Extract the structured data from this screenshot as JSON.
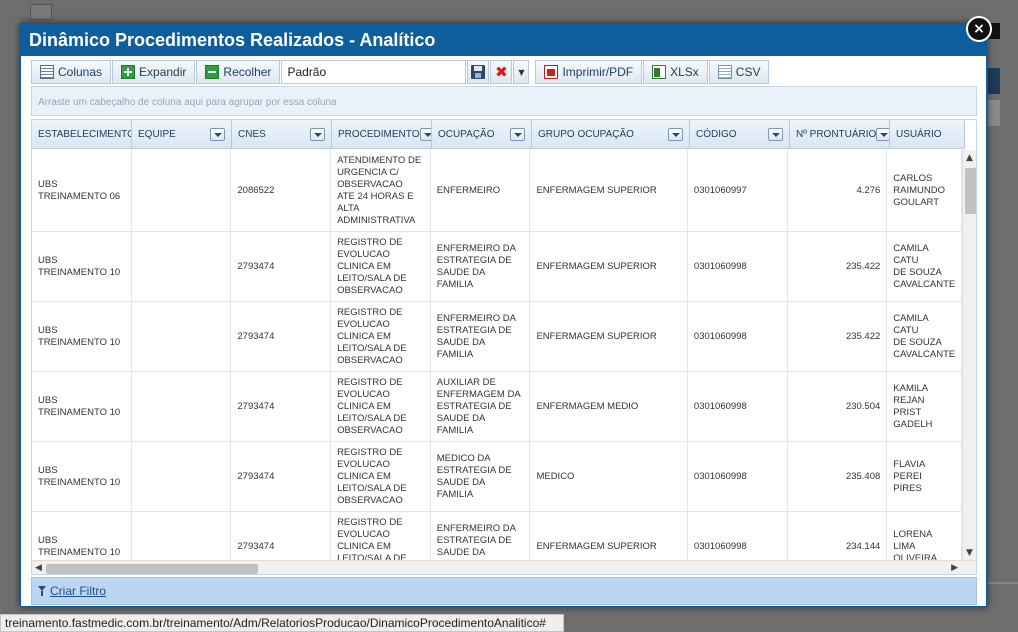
{
  "modal": {
    "title": "Dinâmico Procedimentos Realizados - Analítico",
    "close_label": "×"
  },
  "toolbar": {
    "columns_label": "Colunas",
    "expand_label": "Expandir",
    "collapse_label": "Recolher",
    "layout_value": "Padrão",
    "pdf_label": "Imprimir/PDF",
    "xlsx_label": "XLSx",
    "csv_label": "CSV"
  },
  "group_panel": {
    "hint": "Arraste um cabeçalho de coluna aqui para agrupar por essa coluna"
  },
  "grid": {
    "columns": [
      "ESTABELECIMENTO",
      "EQUIPE",
      "CNES",
      "PROCEDIMENTO",
      "OCUPAÇÃO",
      "GRUPO OCUPAÇÃO",
      "CÓDIGO",
      "Nº PRONTUÁRIO",
      "USUÁRIO"
    ],
    "rows": [
      {
        "estabelecimento": "UBS\nTREINAMENTO 06",
        "equipe": "",
        "cnes": "2086522",
        "procedimento": "ATENDIMENTO DE\nURGENCIA C/\nOBSERVACAO\nATE 24 HORAS E\nALTA\nADMINISTRATIVA",
        "ocupacao": "ENFERMEIRO",
        "grupo": "ENFERMAGEM SUPERIOR",
        "codigo": "0301060997",
        "prontuario": "4.276",
        "usuario": "CARLOS\nRAIMUNDO\nGOULART"
      },
      {
        "estabelecimento": "UBS\nTREINAMENTO 10",
        "equipe": "",
        "cnes": "2793474",
        "procedimento": "REGISTRO DE\nEVOLUCAO\nCLINICA EM\nLEITO/SALA DE\nOBSERVACAO",
        "ocupacao": "ENFERMEIRO DA\nESTRATEGIA DE\nSAUDE DA\nFAMILIA",
        "grupo": "ENFERMAGEM SUPERIOR",
        "codigo": "0301060998",
        "prontuario": "235.422",
        "usuario": "CAMILA CATU\nDE SOUZA\nCAVALCANTE"
      },
      {
        "estabelecimento": "UBS\nTREINAMENTO 10",
        "equipe": "",
        "cnes": "2793474",
        "procedimento": "REGISTRO DE\nEVOLUCAO\nCLINICA EM\nLEITO/SALA DE\nOBSERVACAO",
        "ocupacao": "ENFERMEIRO DA\nESTRATEGIA DE\nSAUDE DA\nFAMILIA",
        "grupo": "ENFERMAGEM SUPERIOR",
        "codigo": "0301060998",
        "prontuario": "235.422",
        "usuario": "CAMILA CATU\nDE SOUZA\nCAVALCANTE"
      },
      {
        "estabelecimento": "UBS\nTREINAMENTO 10",
        "equipe": "",
        "cnes": "2793474",
        "procedimento": "REGISTRO DE\nEVOLUCAO\nCLINICA EM\nLEITO/SALA DE\nOBSERVACAO",
        "ocupacao": "AUXILIAR DE\nENFERMAGEM DA\nESTRATEGIA DE\nSAUDE DA\nFAMILIA",
        "grupo": "ENFERMAGEM MEDIO",
        "codigo": "0301060998",
        "prontuario": "230.504",
        "usuario": "KAMILA REJAN\nPRIST GADELH"
      },
      {
        "estabelecimento": "UBS\nTREINAMENTO 10",
        "equipe": "",
        "cnes": "2793474",
        "procedimento": "REGISTRO DE\nEVOLUCAO\nCLINICA EM\nLEITO/SALA DE\nOBSERVACAO",
        "ocupacao": "MEDICO DA\nESTRATEGIA DE\nSAUDE DA\nFAMILIA",
        "grupo": "MEDICO",
        "codigo": "0301060998",
        "prontuario": "235.408",
        "usuario": "FLAVIA PEREI\nPIRES"
      },
      {
        "estabelecimento": "UBS\nTREINAMENTO 10",
        "equipe": "",
        "cnes": "2793474",
        "procedimento": "REGISTRO DE\nEVOLUCAO\nCLINICA EM\nLEITO/SALA DE\nOBSERVACAO",
        "ocupacao": "ENFERMEIRO DA\nESTRATEGIA DE\nSAUDE DA\nFAMILIA",
        "grupo": "ENFERMAGEM SUPERIOR",
        "codigo": "0301060998",
        "prontuario": "234.144",
        "usuario": "LORENA LIMA\nOLIVEIRA"
      }
    ]
  },
  "footer": {
    "filter_label": "Criar Filtro"
  },
  "statusbar": {
    "url": "treinamento.fastmedic.com.br/treinamento/Adm/RelatoriosProducao/DinamicoProcedimentoAnalitico#"
  },
  "colors": {
    "header_blue": "#0f5e9c",
    "footer_blue": "#bcd6f2",
    "link_blue": "#1d4f91"
  },
  "icons": [
    "columns-icon",
    "expand-icon",
    "collapse-icon",
    "save-icon",
    "delete-icon",
    "chevron-down-icon",
    "pdf-icon",
    "excel-icon",
    "csv-icon",
    "filter-funnel-icon",
    "close-icon"
  ]
}
